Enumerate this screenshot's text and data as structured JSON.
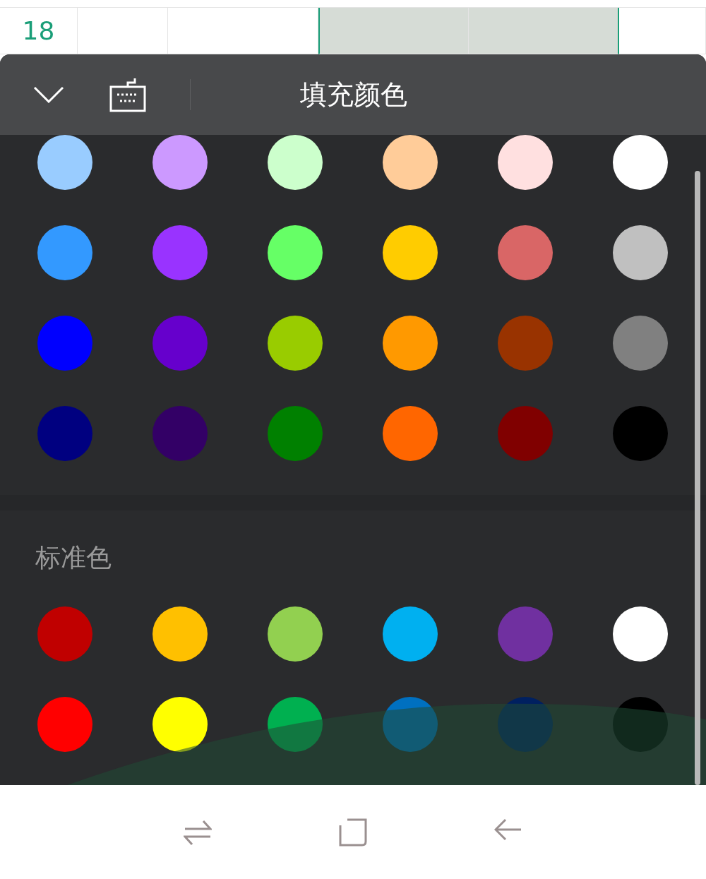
{
  "sheet": {
    "row_number": "18",
    "cells": [
      {
        "selected": false
      },
      {
        "selected": false
      },
      {
        "selected": true
      },
      {
        "selected": true
      },
      {
        "selected": false
      }
    ]
  },
  "panel": {
    "title": "填充颜色",
    "palette": [
      [
        {
          "color": "#99ccff"
        },
        {
          "color": "#cc99ff"
        },
        {
          "color": "#ccffcc"
        },
        {
          "color": "#ffcc99"
        },
        {
          "color": "#ffe0e0"
        },
        {
          "color": "#ffffff"
        }
      ],
      [
        {
          "color": "#3399ff"
        },
        {
          "color": "#9933ff"
        },
        {
          "color": "#66ff66"
        },
        {
          "color": "#ffcc00"
        },
        {
          "color": "#d96666"
        },
        {
          "color": "#c0c0c0"
        }
      ],
      [
        {
          "color": "#0000ff"
        },
        {
          "color": "#6600cc"
        },
        {
          "color": "#99cc00"
        },
        {
          "color": "#ff9900"
        },
        {
          "color": "#993300"
        },
        {
          "color": "#808080"
        }
      ],
      [
        {
          "color": "#000080"
        },
        {
          "color": "#330066"
        },
        {
          "color": "#008000"
        },
        {
          "color": "#ff6600"
        },
        {
          "color": "#800000"
        },
        {
          "color": "#000000"
        }
      ]
    ],
    "standard_label": "标准色",
    "standard_colors": [
      [
        {
          "color": "#c00000"
        },
        {
          "color": "#ffc000"
        },
        {
          "color": "#92d050"
        },
        {
          "color": "#00b0f0"
        },
        {
          "color": "#7030a0"
        },
        {
          "color": "#ffffff"
        }
      ],
      [
        {
          "color": "#ff0000"
        },
        {
          "color": "#ffff00"
        },
        {
          "color": "#00b050"
        },
        {
          "color": "#0070c0"
        },
        {
          "color": "#002060"
        },
        {
          "color": "#000000"
        }
      ]
    ]
  }
}
